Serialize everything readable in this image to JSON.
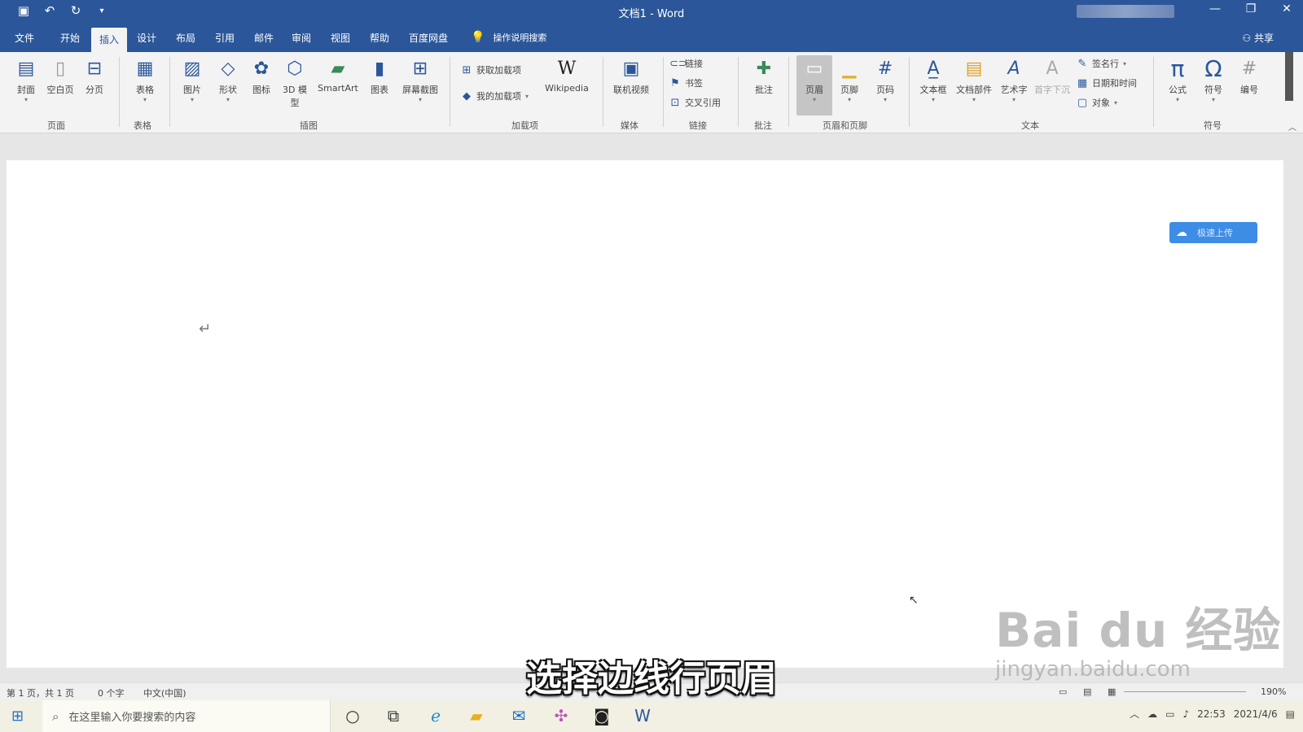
{
  "window": {
    "title": "文档1 - Word",
    "min_icon": "minimize-icon",
    "restore_icon": "restore-icon",
    "close_icon": "close-icon"
  },
  "qat": {
    "save_icon": "save-icon",
    "undo_icon": "undo-icon",
    "redo_icon": "redo-icon",
    "customize_icon": "dropdown-icon"
  },
  "tabs": [
    {
      "label": "文件"
    },
    {
      "label": "开始"
    },
    {
      "label": "插入"
    },
    {
      "label": "设计"
    },
    {
      "label": "布局"
    },
    {
      "label": "引用"
    },
    {
      "label": "邮件"
    },
    {
      "label": "审阅"
    },
    {
      "label": "视图"
    },
    {
      "label": "帮助"
    },
    {
      "label": "百度网盘"
    }
  ],
  "tell_me": "操作说明搜索",
  "share": "共享",
  "ribbon": {
    "pages": {
      "cover": "封面",
      "blank": "空白页",
      "break": "分页",
      "group": "页面"
    },
    "tables": {
      "table": "表格",
      "group": "表格"
    },
    "illustrations": {
      "pictures": "图片",
      "shapes": "形状",
      "icons": "图标",
      "models": "3D 模型",
      "smartart": "SmartArt",
      "chart": "图表",
      "screenshot": "屏幕截图",
      "group": "插图"
    },
    "addins": {
      "get": "获取加载项",
      "mine": "我的加载项",
      "wikipedia": "Wikipedia",
      "group": "加载项"
    },
    "media": {
      "video": "联机视频",
      "group": "媒体"
    },
    "links": {
      "link": "链接",
      "bookmark": "书签",
      "crossref": "交叉引用",
      "group": "链接"
    },
    "comments": {
      "comment": "批注",
      "group": "批注"
    },
    "header_footer": {
      "header": "页眉",
      "footer": "页脚",
      "page_number": "页码",
      "group": "页眉和页脚"
    },
    "text": {
      "textbox": "文本框",
      "quickparts": "文档部件",
      "wordart": "艺术字",
      "dropcap": "首字下沉",
      "signature": "签名行",
      "datetime": "日期和时间",
      "object": "对象",
      "group": "文本"
    },
    "symbols": {
      "equation": "公式",
      "symbol": "符号",
      "number": "编号",
      "group": "符号"
    }
  },
  "document": {
    "upload_button": "极速上传"
  },
  "statusbar": {
    "page": "第 1 页，共 1 页",
    "words": "0 个字",
    "language": "中文(中国)",
    "zoom": "190%"
  },
  "subtitle": "选择边线行页眉",
  "watermark": {
    "logo": "Bai du 经验",
    "url": "jingyan.baidu.com"
  },
  "taskbar": {
    "search_placeholder": "在这里输入你要搜索的内容",
    "time": "22:53",
    "date": "2021/4/6"
  }
}
